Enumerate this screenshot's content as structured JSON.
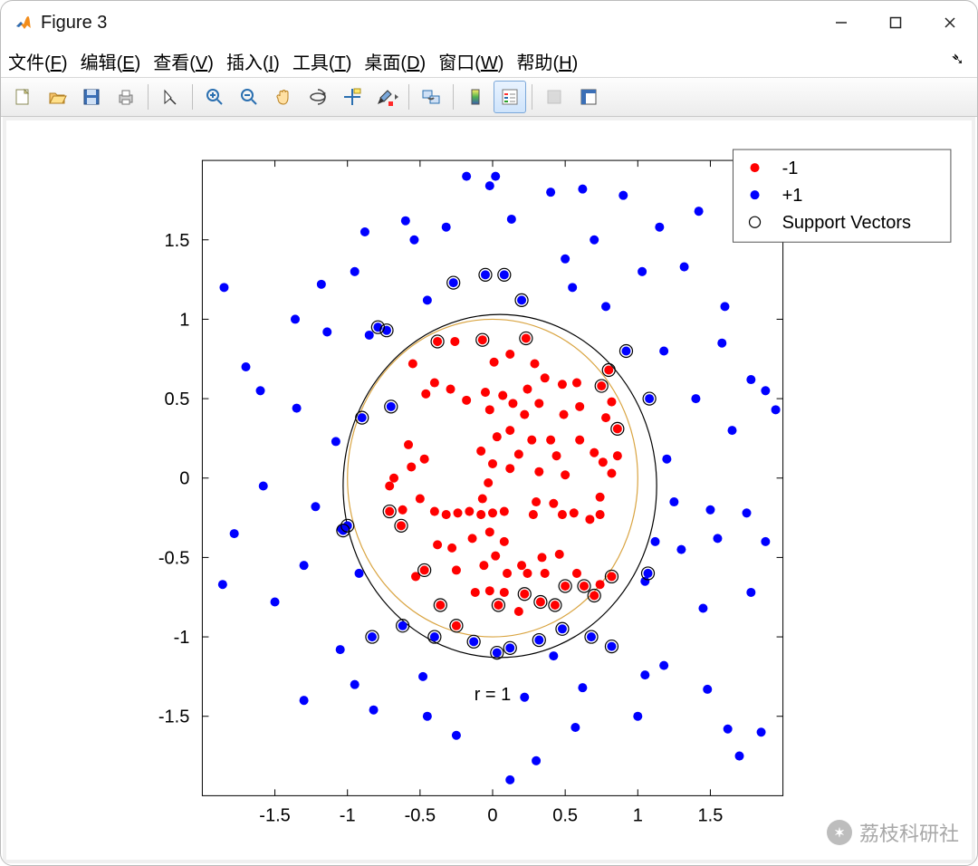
{
  "window": {
    "title": "Figure 3"
  },
  "menu": {
    "file": {
      "label": "文件",
      "mn": "F"
    },
    "edit": {
      "label": "编辑",
      "mn": "E"
    },
    "view": {
      "label": "查看",
      "mn": "V"
    },
    "insert": {
      "label": "插入",
      "mn": "I"
    },
    "tools": {
      "label": "工具",
      "mn": "T"
    },
    "desktop": {
      "label": "桌面",
      "mn": "D"
    },
    "window_": {
      "label": "窗口",
      "mn": "W"
    },
    "help": {
      "label": "帮助",
      "mn": "H"
    }
  },
  "legend": {
    "neg": "-1",
    "pos": "+1",
    "sv": "Support Vectors"
  },
  "annot": {
    "r_eq_1": "r = 1"
  },
  "watermark": {
    "text": "荔枝科研社"
  },
  "chart_data": {
    "type": "scatter",
    "xlim": [
      -2,
      2
    ],
    "ylim": [
      -2,
      2
    ],
    "xticks": [
      -1.5,
      -1,
      -0.5,
      0,
      0.5,
      1,
      1.5
    ],
    "yticks": [
      -1.5,
      -1,
      -0.5,
      0,
      0.5,
      1,
      1.5
    ],
    "annotation": {
      "text": "r = 1",
      "x": 0,
      "y": -1.4
    },
    "circles": [
      {
        "name": "unit",
        "cx": 0,
        "cy": 0,
        "r": 1,
        "color": "#d9a441"
      },
      {
        "name": "boundary",
        "cx": 0.05,
        "cy": -0.05,
        "r": 1.08,
        "color": "#000000"
      }
    ],
    "series": [
      {
        "name": "-1",
        "color": "#ff0000",
        "marker": "filled-circle",
        "points": [
          [
            -0.38,
            0.86
          ],
          [
            -0.26,
            0.86
          ],
          [
            -0.07,
            0.87
          ],
          [
            0.23,
            0.88
          ],
          [
            0.12,
            0.78
          ],
          [
            0.01,
            0.73
          ],
          [
            0.29,
            0.72
          ],
          [
            -0.55,
            0.72
          ],
          [
            -0.4,
            0.6
          ],
          [
            -0.29,
            0.56
          ],
          [
            -0.46,
            0.53
          ],
          [
            -0.18,
            0.49
          ],
          [
            0.24,
            0.56
          ],
          [
            0.36,
            0.63
          ],
          [
            0.48,
            0.59
          ],
          [
            0.58,
            0.6
          ],
          [
            0.75,
            0.58
          ],
          [
            0.8,
            0.68
          ],
          [
            0.14,
            0.47
          ],
          [
            0.07,
            0.52
          ],
          [
            -0.05,
            0.54
          ],
          [
            -0.02,
            0.43
          ],
          [
            0.32,
            0.47
          ],
          [
            0.22,
            0.4
          ],
          [
            0.49,
            0.4
          ],
          [
            0.6,
            0.45
          ],
          [
            0.78,
            0.38
          ],
          [
            0.82,
            0.48
          ],
          [
            0.86,
            0.31
          ],
          [
            0.12,
            0.3
          ],
          [
            0.03,
            0.26
          ],
          [
            0.27,
            0.24
          ],
          [
            0.4,
            0.24
          ],
          [
            0.6,
            0.24
          ],
          [
            -0.08,
            0.17
          ],
          [
            0.18,
            0.15
          ],
          [
            0.44,
            0.14
          ],
          [
            0.7,
            0.16
          ],
          [
            0.76,
            0.1
          ],
          [
            0.86,
            0.14
          ],
          [
            0.0,
            0.09
          ],
          [
            0.12,
            0.06
          ],
          [
            0.32,
            0.04
          ],
          [
            0.5,
            0.02
          ],
          [
            0.82,
            0.03
          ],
          [
            -0.03,
            -0.03
          ],
          [
            -0.07,
            -0.13
          ],
          [
            -0.68,
            0.0
          ],
          [
            -0.56,
            0.07
          ],
          [
            -0.47,
            0.12
          ],
          [
            -0.58,
            0.21
          ],
          [
            -0.71,
            -0.05
          ],
          [
            -0.62,
            -0.2
          ],
          [
            -0.63,
            -0.3
          ],
          [
            -0.5,
            -0.13
          ],
          [
            -0.4,
            -0.21
          ],
          [
            -0.32,
            -0.23
          ],
          [
            -0.24,
            -0.22
          ],
          [
            -0.16,
            -0.21
          ],
          [
            -0.08,
            -0.23
          ],
          [
            0.0,
            -0.22
          ],
          [
            0.08,
            -0.21
          ],
          [
            0.28,
            -0.23
          ],
          [
            0.3,
            -0.15
          ],
          [
            0.42,
            -0.16
          ],
          [
            0.48,
            -0.23
          ],
          [
            0.56,
            -0.22
          ],
          [
            0.67,
            -0.26
          ],
          [
            0.74,
            -0.23
          ],
          [
            0.74,
            -0.12
          ],
          [
            -0.71,
            -0.21
          ],
          [
            -0.02,
            -0.34
          ],
          [
            -0.14,
            -0.38
          ],
          [
            -0.28,
            -0.44
          ],
          [
            -0.38,
            -0.42
          ],
          [
            0.08,
            -0.4
          ],
          [
            0.02,
            -0.49
          ],
          [
            -0.06,
            -0.55
          ],
          [
            -0.47,
            -0.58
          ],
          [
            -0.53,
            -0.62
          ],
          [
            -0.12,
            -0.72
          ],
          [
            -0.02,
            -0.71
          ],
          [
            0.08,
            -0.72
          ],
          [
            0.04,
            -0.8
          ],
          [
            0.18,
            -0.84
          ],
          [
            0.22,
            -0.73
          ],
          [
            0.33,
            -0.78
          ],
          [
            0.43,
            -0.8
          ],
          [
            0.36,
            -0.6
          ],
          [
            0.24,
            -0.6
          ],
          [
            0.5,
            -0.68
          ],
          [
            0.58,
            -0.6
          ],
          [
            0.63,
            -0.68
          ],
          [
            0.7,
            -0.74
          ],
          [
            0.82,
            -0.62
          ],
          [
            0.34,
            -0.5
          ],
          [
            -0.25,
            -0.58
          ],
          [
            0.1,
            -0.6
          ],
          [
            0.2,
            -0.55
          ],
          [
            0.46,
            -0.48
          ],
          [
            0.74,
            -0.67
          ],
          [
            -0.36,
            -0.8
          ],
          [
            -0.25,
            -0.93
          ]
        ]
      },
      {
        "name": "+1",
        "color": "#0000ff",
        "marker": "filled-circle",
        "points": [
          [
            -1.78,
            -0.35
          ],
          [
            -1.86,
            -0.67
          ],
          [
            -1.7,
            0.7
          ],
          [
            -1.6,
            0.55
          ],
          [
            -1.58,
            -0.05
          ],
          [
            -1.5,
            -0.78
          ],
          [
            -1.36,
            1.0
          ],
          [
            -1.35,
            0.44
          ],
          [
            -1.3,
            -0.55
          ],
          [
            -1.22,
            -0.18
          ],
          [
            -1.18,
            1.22
          ],
          [
            -1.14,
            0.92
          ],
          [
            -1.08,
            0.23
          ],
          [
            -1.04,
            -0.32
          ],
          [
            -1.03,
            -0.33
          ],
          [
            -1.0,
            -0.3
          ],
          [
            -0.95,
            1.3
          ],
          [
            -0.92,
            -0.6
          ],
          [
            -0.9,
            0.38
          ],
          [
            -0.88,
            1.55
          ],
          [
            -0.85,
            0.9
          ],
          [
            -0.83,
            -1.0
          ],
          [
            -0.82,
            -1.46
          ],
          [
            -0.79,
            0.95
          ],
          [
            -0.73,
            0.93
          ],
          [
            -0.7,
            0.45
          ],
          [
            -0.62,
            -0.93
          ],
          [
            -0.6,
            1.62
          ],
          [
            -0.54,
            1.5
          ],
          [
            -0.48,
            -1.25
          ],
          [
            -0.45,
            1.12
          ],
          [
            -0.45,
            -1.5
          ],
          [
            -0.4,
            -1.0
          ],
          [
            -0.32,
            1.58
          ],
          [
            -0.27,
            1.23
          ],
          [
            -0.25,
            -1.62
          ],
          [
            -0.18,
            1.9
          ],
          [
            -0.13,
            -1.03
          ],
          [
            -0.05,
            1.28
          ],
          [
            -0.02,
            1.84
          ],
          [
            0.02,
            1.9
          ],
          [
            0.03,
            -1.1
          ],
          [
            0.08,
            1.28
          ],
          [
            0.12,
            -1.9
          ],
          [
            0.13,
            1.63
          ],
          [
            0.2,
            1.12
          ],
          [
            0.22,
            -1.38
          ],
          [
            0.3,
            -1.78
          ],
          [
            0.4,
            1.8
          ],
          [
            0.42,
            -1.12
          ],
          [
            0.5,
            1.38
          ],
          [
            0.55,
            1.2
          ],
          [
            0.57,
            -1.57
          ],
          [
            0.62,
            1.82
          ],
          [
            0.62,
            -1.32
          ],
          [
            0.68,
            -1.0
          ],
          [
            0.7,
            1.5
          ],
          [
            0.78,
            1.08
          ],
          [
            0.82,
            -1.06
          ],
          [
            0.9,
            1.78
          ],
          [
            0.92,
            0.8
          ],
          [
            1.0,
            -1.5
          ],
          [
            1.03,
            1.3
          ],
          [
            1.05,
            -1.24
          ],
          [
            1.05,
            -0.65
          ],
          [
            1.07,
            -0.6
          ],
          [
            1.08,
            0.5
          ],
          [
            1.12,
            -0.4
          ],
          [
            1.15,
            1.58
          ],
          [
            1.18,
            -1.18
          ],
          [
            1.18,
            0.8
          ],
          [
            1.2,
            0.12
          ],
          [
            1.25,
            -0.15
          ],
          [
            1.3,
            -0.45
          ],
          [
            1.32,
            1.33
          ],
          [
            1.4,
            0.5
          ],
          [
            1.42,
            1.68
          ],
          [
            1.45,
            -0.82
          ],
          [
            1.48,
            -1.33
          ],
          [
            1.5,
            -0.2
          ],
          [
            1.55,
            -0.38
          ],
          [
            1.58,
            0.85
          ],
          [
            1.6,
            1.08
          ],
          [
            1.62,
            -1.58
          ],
          [
            1.65,
            0.3
          ],
          [
            1.7,
            -1.75
          ],
          [
            1.75,
            -0.22
          ],
          [
            1.78,
            0.62
          ],
          [
            1.78,
            -0.72
          ],
          [
            1.85,
            -1.6
          ],
          [
            1.88,
            0.55
          ],
          [
            1.88,
            -0.4
          ],
          [
            1.95,
            0.43
          ],
          [
            -0.95,
            -1.3
          ],
          [
            -1.05,
            -1.08
          ],
          [
            -1.3,
            -1.4
          ],
          [
            0.48,
            -0.95
          ],
          [
            0.32,
            -1.02
          ],
          [
            0.12,
            -1.07
          ],
          [
            -1.85,
            1.2
          ]
        ]
      },
      {
        "name": "Support Vectors",
        "color": "#000000",
        "marker": "open-circle",
        "points": [
          [
            -1.0,
            -0.3
          ],
          [
            -1.03,
            -0.33
          ],
          [
            -0.9,
            0.38
          ],
          [
            -0.83,
            -1.0
          ],
          [
            -0.79,
            0.95
          ],
          [
            -0.73,
            0.93
          ],
          [
            -0.7,
            0.45
          ],
          [
            -0.62,
            -0.93
          ],
          [
            -0.4,
            -1.0
          ],
          [
            -0.27,
            1.23
          ],
          [
            -0.13,
            -1.03
          ],
          [
            -0.05,
            1.28
          ],
          [
            0.03,
            -1.1
          ],
          [
            0.08,
            1.28
          ],
          [
            0.2,
            1.12
          ],
          [
            0.48,
            -0.95
          ],
          [
            0.68,
            -1.0
          ],
          [
            0.82,
            -1.06
          ],
          [
            0.92,
            0.8
          ],
          [
            1.07,
            -0.6
          ],
          [
            1.08,
            0.5
          ],
          [
            -0.71,
            -0.21
          ],
          [
            -0.63,
            -0.3
          ],
          [
            -0.47,
            -0.58
          ],
          [
            -0.36,
            -0.8
          ],
          [
            -0.25,
            -0.93
          ],
          [
            -0.38,
            0.86
          ],
          [
            -0.07,
            0.87
          ],
          [
            0.23,
            0.88
          ],
          [
            0.75,
            0.58
          ],
          [
            0.8,
            0.68
          ],
          [
            0.86,
            0.31
          ],
          [
            0.82,
            -0.62
          ],
          [
            0.7,
            -0.74
          ],
          [
            0.33,
            -0.78
          ],
          [
            0.43,
            -0.8
          ],
          [
            0.22,
            -0.73
          ],
          [
            0.04,
            -0.8
          ],
          [
            0.63,
            -0.68
          ],
          [
            0.32,
            -1.02
          ],
          [
            0.12,
            -1.07
          ],
          [
            0.5,
            -0.68
          ]
        ]
      }
    ]
  }
}
